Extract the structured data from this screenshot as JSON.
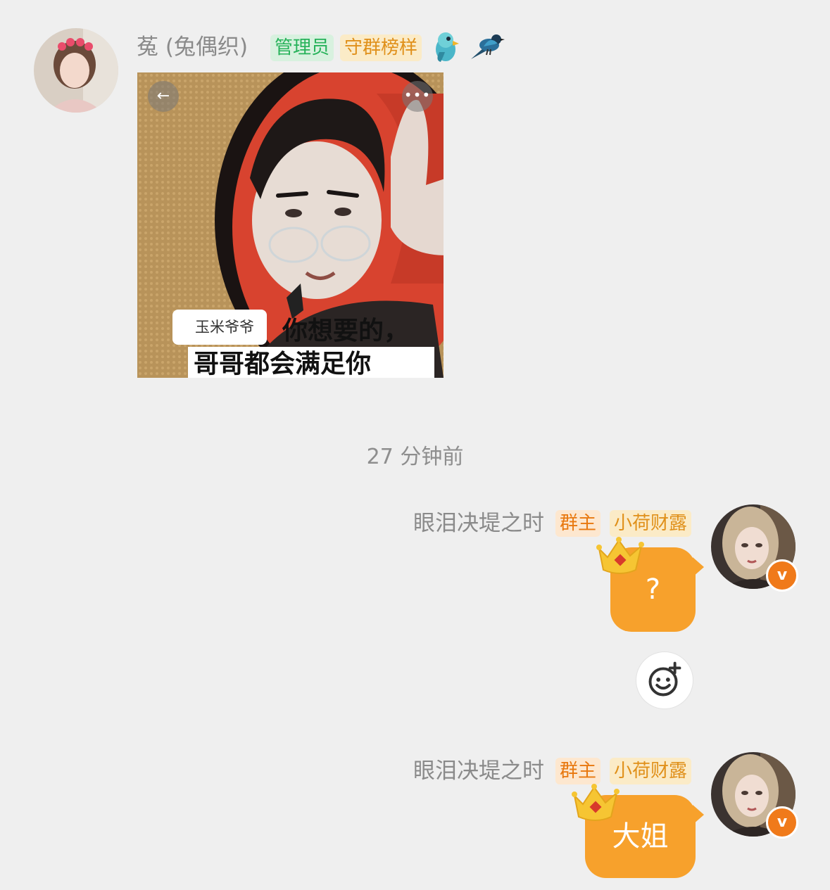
{
  "message1": {
    "sender_name": "菟 (兔偶织)",
    "badges": [
      "管理员",
      "守群榜样"
    ],
    "emoji_icons": [
      "parrot-icon",
      "magpie-icon"
    ],
    "meme": {
      "caption_tag": "玉米爷爷",
      "caption_line1": "你想要的，",
      "caption_line2": "哥哥都会满足你"
    }
  },
  "timestamp": "27 分钟前",
  "message2": {
    "sender_name": "眼泪决堤之时",
    "badges": [
      "群主",
      "小荷财露"
    ],
    "text": "?"
  },
  "message3": {
    "sender_name": "眼泪决堤之时",
    "badges": [
      "群主",
      "小荷财露"
    ],
    "text": "大姐"
  },
  "verified_mark": "v",
  "colors": {
    "background": "#efefef",
    "bubble": "#f7a12c",
    "admin_badge": "#27b25a",
    "owner_badge": "#e8780f"
  }
}
